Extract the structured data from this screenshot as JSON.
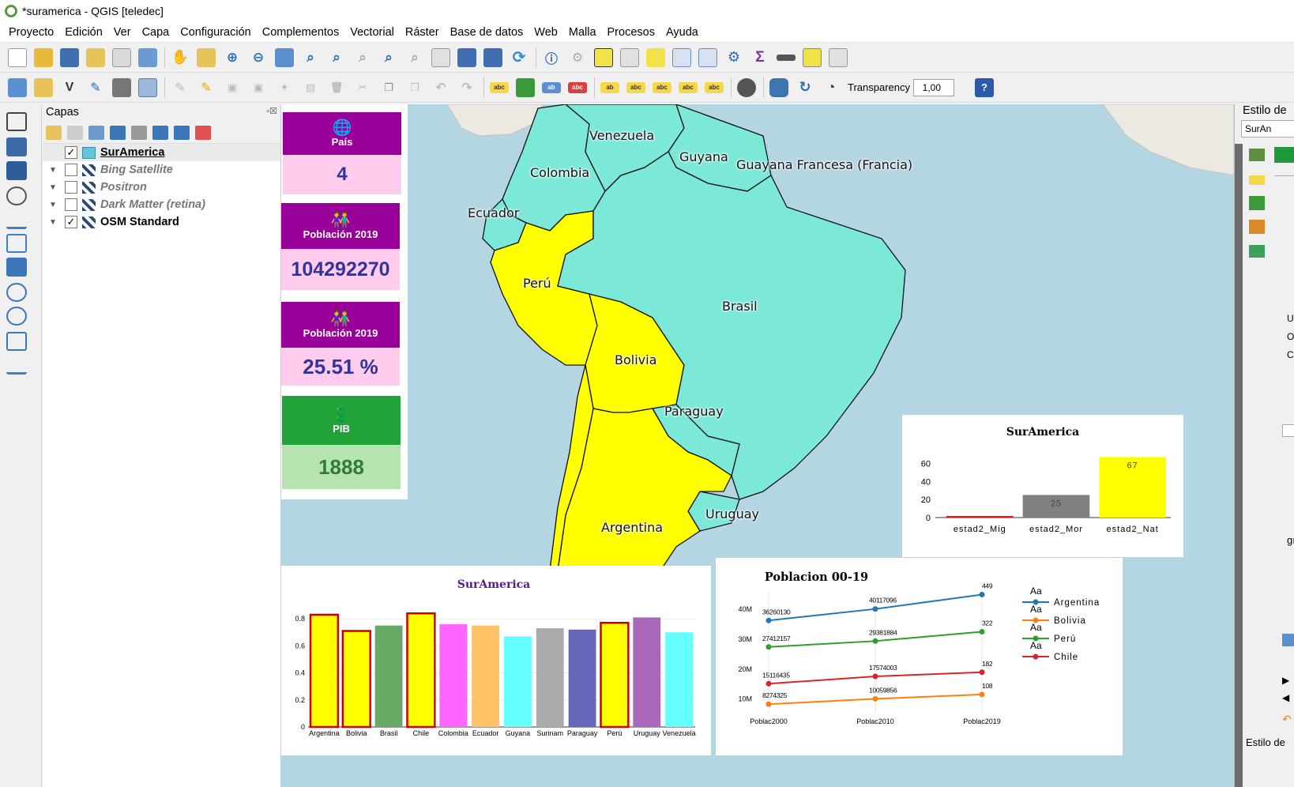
{
  "window": {
    "title": "*suramerica - QGIS [teledec]"
  },
  "menu": [
    "Proyecto",
    "Edición",
    "Ver",
    "Capa",
    "Configuración",
    "Complementos",
    "Vectorial",
    "Ráster",
    "Base de datos",
    "Web",
    "Malla",
    "Procesos",
    "Ayuda"
  ],
  "toolbar2": {
    "transparency_label": "Transparency",
    "transparency_value": "1,00"
  },
  "layers_panel": {
    "title": "Capas",
    "layers": [
      {
        "name": "SurAmerica",
        "checked": "✓",
        "style": "bold-underline"
      },
      {
        "name": "Bing Satellite",
        "checked": "",
        "style": "italic"
      },
      {
        "name": "Positron",
        "checked": "",
        "style": "italic"
      },
      {
        "name": "Dark Matter (retina)",
        "checked": "",
        "style": "italic"
      },
      {
        "name": "OSM Standard",
        "checked": "✓",
        "style": "bold"
      }
    ]
  },
  "map_labels": {
    "venezuela": "Venezuela",
    "colombia": "Colombia",
    "guyana": "Guyana",
    "guayana_francesa": "Guayana Francesa (Francia)",
    "ecuador": "Ecuador",
    "peru": "Perú",
    "brasil": "Brasil",
    "bolivia": "Bolivia",
    "paraguay": "Paraguay",
    "uruguay": "Uruguay",
    "argentina": "Argentina"
  },
  "cards": [
    {
      "title": "País",
      "value": "4",
      "icon": "globe-icon",
      "top_color": "#990099",
      "bottom_color": "#ffccee",
      "value_color": "#333399"
    },
    {
      "title": "Población 2019",
      "value": "104292270",
      "icon": "people-icon",
      "top_color": "#990099",
      "bottom_color": "#ffccee",
      "value_color": "#333399"
    },
    {
      "title": "Población 2019",
      "value": "25.51 %",
      "icon": "people-icon",
      "top_color": "#990099",
      "bottom_color": "#ffccee",
      "value_color": "#333399"
    },
    {
      "title": "PIB",
      "value": "1888",
      "icon": "dollar-icon",
      "top_color": "#22a33a",
      "bottom_color": "#b7e3b0",
      "value_color": "#2f7f32"
    }
  ],
  "right_panel": {
    "title": "Estilo de",
    "layer_label": "SurAn",
    "row1": "Unic",
    "row2": "Opa",
    "row3": "Colo",
    "side_text": "gı",
    "bottom_tab": "Estilo de"
  },
  "chart_data": [
    {
      "type": "bar",
      "title": "SurAmerica",
      "categories": [
        "estad2_Mig",
        "estad2_Mor",
        "estad2_Nat"
      ],
      "values": [
        0,
        25,
        67
      ],
      "data_labels": [
        "",
        "25",
        "67"
      ],
      "colors": [
        "#e31a1c",
        "#808080",
        "#ffff00"
      ],
      "ylim": [
        0,
        70
      ],
      "yticks": [
        0,
        20,
        40,
        60
      ]
    },
    {
      "type": "bar",
      "title": "SurAmerica",
      "categories": [
        "Argentina",
        "Bolivia",
        "Brasil",
        "Chile",
        "Colombia",
        "Ecuador",
        "Guyana",
        "Surinam",
        "Paraguay",
        "Perú",
        "Uruguay",
        "Venezuela"
      ],
      "values": [
        0.83,
        0.71,
        0.75,
        0.84,
        0.76,
        0.75,
        0.67,
        0.73,
        0.72,
        0.77,
        0.81,
        0.7
      ],
      "colors": [
        "#ffff00",
        "#ffff00",
        "#66aa66",
        "#ffff00",
        "#ff66ff",
        "#ffc266",
        "#66ffff",
        "#aaaaaa",
        "#6666bb",
        "#ffff00",
        "#aa66bb",
        "#66ffff"
      ],
      "highlighted": [
        "Argentina",
        "Bolivia",
        "Chile",
        "Perú"
      ],
      "ylim": [
        0,
        0.9
      ],
      "yticks": [
        "0",
        "0.2",
        "0.4",
        "0.6",
        "0.8"
      ]
    },
    {
      "type": "line",
      "title": "Poblacion 00-19",
      "x": [
        "Poblac2000",
        "Poblac2010",
        "Poblac2019"
      ],
      "ylim": [
        7000000,
        44000000
      ],
      "yticks": [
        {
          "v": 10000000,
          "label": "10M"
        },
        {
          "v": 20000000,
          "label": "20M"
        },
        {
          "v": 30000000,
          "label": "30M"
        },
        {
          "v": 40000000,
          "label": "40M"
        }
      ],
      "legend_marker": "Aa",
      "series": [
        {
          "name": "Argentina",
          "color": "#1f77b4",
          "values": [
            36260130,
            40117096,
            44938712
          ],
          "labels": [
            "36260130",
            "40117096",
            "449"
          ]
        },
        {
          "name": "Bolivia",
          "color": "#ff7f0e",
          "values": [
            8274325,
            10059856,
            11513100
          ],
          "labels": [
            "8274325",
            "10059856",
            "108"
          ]
        },
        {
          "name": "Perú",
          "color": "#2ca02c",
          "values": [
            27412157,
            29381884,
            32510453
          ],
          "labels": [
            "27412157",
            "29381884",
            "322"
          ]
        },
        {
          "name": "Chile",
          "color": "#d62728",
          "values": [
            15116435,
            17574003,
            18952038
          ],
          "labels": [
            "15116435",
            "17574003",
            "182"
          ]
        }
      ]
    }
  ]
}
